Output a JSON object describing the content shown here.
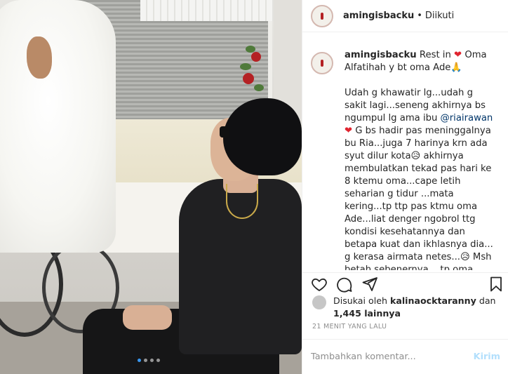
{
  "post": {
    "username": "amingisbacku",
    "separator": "•",
    "follow_status": "Diikuti"
  },
  "caption": {
    "username": "amingisbacku",
    "line1_text": "Rest in",
    "heart_1": "❤",
    "line1_after": "Oma Alfatihah y bt oma Ade🙏",
    "body_part1": "Udah g khawatir lg...udah g sakit lagi...seneng akhirnya bs ngumpul lg ama ibu",
    "mention": "@riairawan",
    "heart_2": "❤",
    "body_part2": "G bs hadir pas meninggalnya bu Ria...juga 7 harinya krn ada syut dilur kota😥 akhirnya membulatkan tekad pas hari ke 8 ktemu oma...cape letih seharian g tidur ...mata kering...tp ttp pas ktmu oma Ade...liat denger ngobrol ttg kondisi kesehatannya dan betapa kuat dan ikhlasnya dia... g kerasa airmata netes...😥 Msh betah sebenernya ...tp oma harus istirahat dan mau solat isya...sy cium tangannya pipinya keningnya...sebelum sy"
  },
  "likes": {
    "prefix": "Disukai oleh",
    "user": "kalinaocktaranny",
    "connector": "dan",
    "count": "1,445 lainnya"
  },
  "timestamp": "21 MENIT YANG LALU",
  "comment": {
    "placeholder": "Tambahkan komentar...",
    "post_label": "Kirim"
  },
  "carousel": {
    "total": 4,
    "active_index": 0
  },
  "icons": {
    "like": "heart-outline-icon",
    "comment": "comment-bubble-icon",
    "share": "paper-plane-icon",
    "save": "bookmark-icon"
  }
}
